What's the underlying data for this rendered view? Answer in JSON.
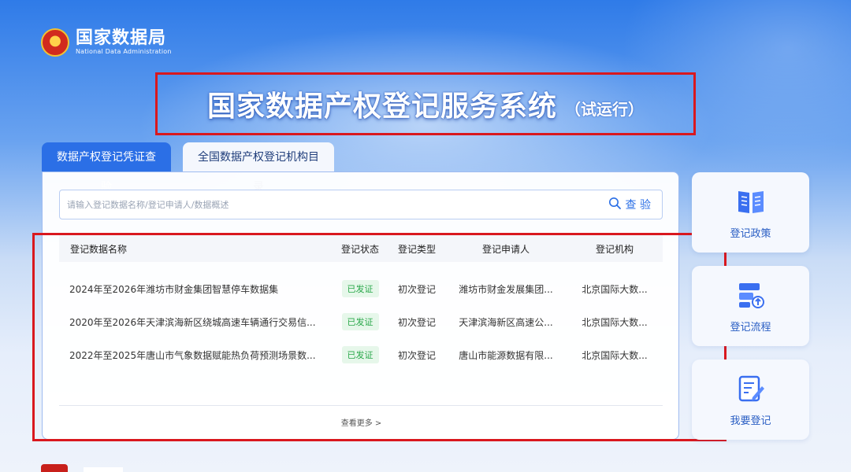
{
  "header": {
    "logo_cn": "国家数据局",
    "logo_en": "National Data Administration",
    "title": "国家数据产权登记服务系统",
    "title_note": "（试运行）"
  },
  "tabs": [
    {
      "label": "数据产权登记凭证查验",
      "active": true
    },
    {
      "label": "全国数据产权登记机构目录",
      "active": false
    }
  ],
  "search": {
    "placeholder": "请输入登记数据名称/登记申请人/数据概述",
    "value": "",
    "button_label": "查 验"
  },
  "table": {
    "columns": [
      "登记数据名称",
      "登记状态",
      "登记类型",
      "登记申请人",
      "登记机构"
    ],
    "rows": [
      {
        "name": "2024年至2026年潍坊市财金集团智慧停车数据集",
        "status": "已发证",
        "type": "初次登记",
        "applicant": "潍坊市财金发展集团...",
        "org": "北京国际大数..."
      },
      {
        "name": "2020年至2026年天津滨海新区绕城高速车辆通行交易信...",
        "status": "已发证",
        "type": "初次登记",
        "applicant": "天津滨海新区高速公...",
        "org": "北京国际大数..."
      },
      {
        "name": "2022年至2025年唐山市气象数据赋能热负荷预测场景数...",
        "status": "已发证",
        "type": "初次登记",
        "applicant": "唐山市能源数据有限...",
        "org": "北京国际大数..."
      }
    ],
    "more_label": "查看更多 >"
  },
  "side": [
    {
      "label": "登记政策",
      "icon": "policy-book-icon"
    },
    {
      "label": "登记流程",
      "icon": "process-flow-icon"
    },
    {
      "label": "我要登记",
      "icon": "register-edit-icon"
    }
  ],
  "colors": {
    "accent": "#2b6fe6",
    "highlight_box": "#d9181e",
    "status_ok": "#2aa84a"
  }
}
